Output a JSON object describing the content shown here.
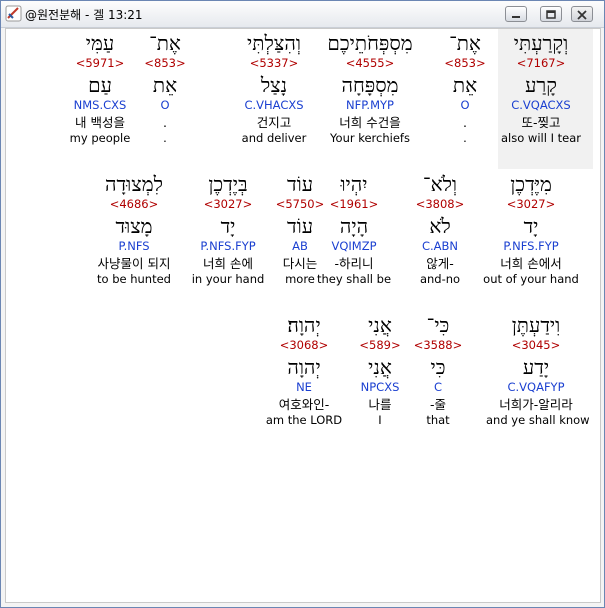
{
  "window": {
    "title": "@원전분해 - 겔 13:21",
    "buttons": [
      "minimize",
      "maximize",
      "close"
    ]
  },
  "rows": [
    {
      "words": [
        {
          "heb": "וְקָרַעְתִּי",
          "strong": "<7167>",
          "lemma": "קָרַע",
          "morph": "C.VQACXS",
          "ko": "또-찢고",
          "en": "also will I tear",
          "highlighted": true
        },
        {
          "heb": "אֶת־",
          "strong": "<853>",
          "lemma": "אֵת",
          "morph": "O",
          "ko": ".",
          "en": "."
        },
        {
          "heb": "מִסְפְּחֹתֵיכֶם",
          "strong": "<4555>",
          "lemma": "מִסְפָּחָה",
          "morph": "NFP.MYP",
          "ko": "너희 수건을",
          "en": "Your kerchiefs"
        },
        {
          "heb": "וְהִצַּלְתִּי",
          "strong": "<5337>",
          "lemma": "נָצַל",
          "morph": "C.VHACXS",
          "ko": "건지고",
          "en": "and deliver"
        },
        {
          "heb": "אֶת־",
          "strong": "<853>",
          "lemma": "אֵת",
          "morph": "O",
          "ko": ".",
          "en": "."
        },
        {
          "heb": "עַמִּי",
          "strong": "<5971>",
          "lemma": "עַם",
          "morph": "NMS.CXS",
          "ko": "내 백성을",
          "en": "my people"
        }
      ]
    },
    {
      "words": [
        {
          "heb": "מִיֶּדְכֶן",
          "strong": "<3027>",
          "lemma": "יָד",
          "morph": "P.NFS.FYP",
          "ko": "너희 손에서",
          "en": "out of your hand"
        },
        {
          "heb": "וְלֹא־",
          "strong": "<3808>",
          "lemma": "לֹא",
          "morph": "C.ABN",
          "ko": "않게-",
          "en": "and-no"
        },
        {
          "heb": "יִהְיוּ",
          "strong": "<1961>",
          "lemma": "הָיָה",
          "morph": "VQIMZP",
          "ko": "-하리니",
          "en": "they shall be"
        },
        {
          "heb": "עוֹד",
          "strong": "<5750>",
          "lemma": "עוֹד",
          "morph": "AB",
          "ko": "다시는",
          "en": "more"
        },
        {
          "heb": "בְּיֶדְכֶן",
          "strong": "<3027>",
          "lemma": "יָד",
          "morph": "P.NFS.FYP",
          "ko": "너희 손에",
          "en": "in your hand"
        },
        {
          "heb": "לִמְצוּדָה",
          "strong": "<4686>",
          "lemma": "מָצוּד",
          "morph": "P.NFS",
          "ko": "사냥물이 되지",
          "en": "to be hunted"
        }
      ]
    },
    {
      "words": [
        {
          "heb": "וִידַעְתֶּן",
          "strong": "<3045>",
          "lemma": "יָדַע",
          "morph": "C.VQAFYP",
          "ko": "너희가-알리라",
          "en": "and ye shall know"
        },
        {
          "heb": "כִּי־",
          "strong": "<3588>",
          "lemma": "כִּי",
          "morph": "C",
          "ko": "-줄",
          "en": "that"
        },
        {
          "heb": "אֲנִי",
          "strong": "<589>",
          "lemma": "אֲנִי",
          "morph": "NPCXS",
          "ko": "나를",
          "en": "I"
        },
        {
          "heb": "יְהוָה׃",
          "strong": "<3068>",
          "lemma": "יְהוָה",
          "morph": "NE",
          "ko": "여호와인-",
          "en": "am the LORD"
        }
      ]
    }
  ],
  "colors": {
    "strong": "#b00000",
    "morph": "#1a3fd0",
    "highlight": "#f1f1f1"
  }
}
